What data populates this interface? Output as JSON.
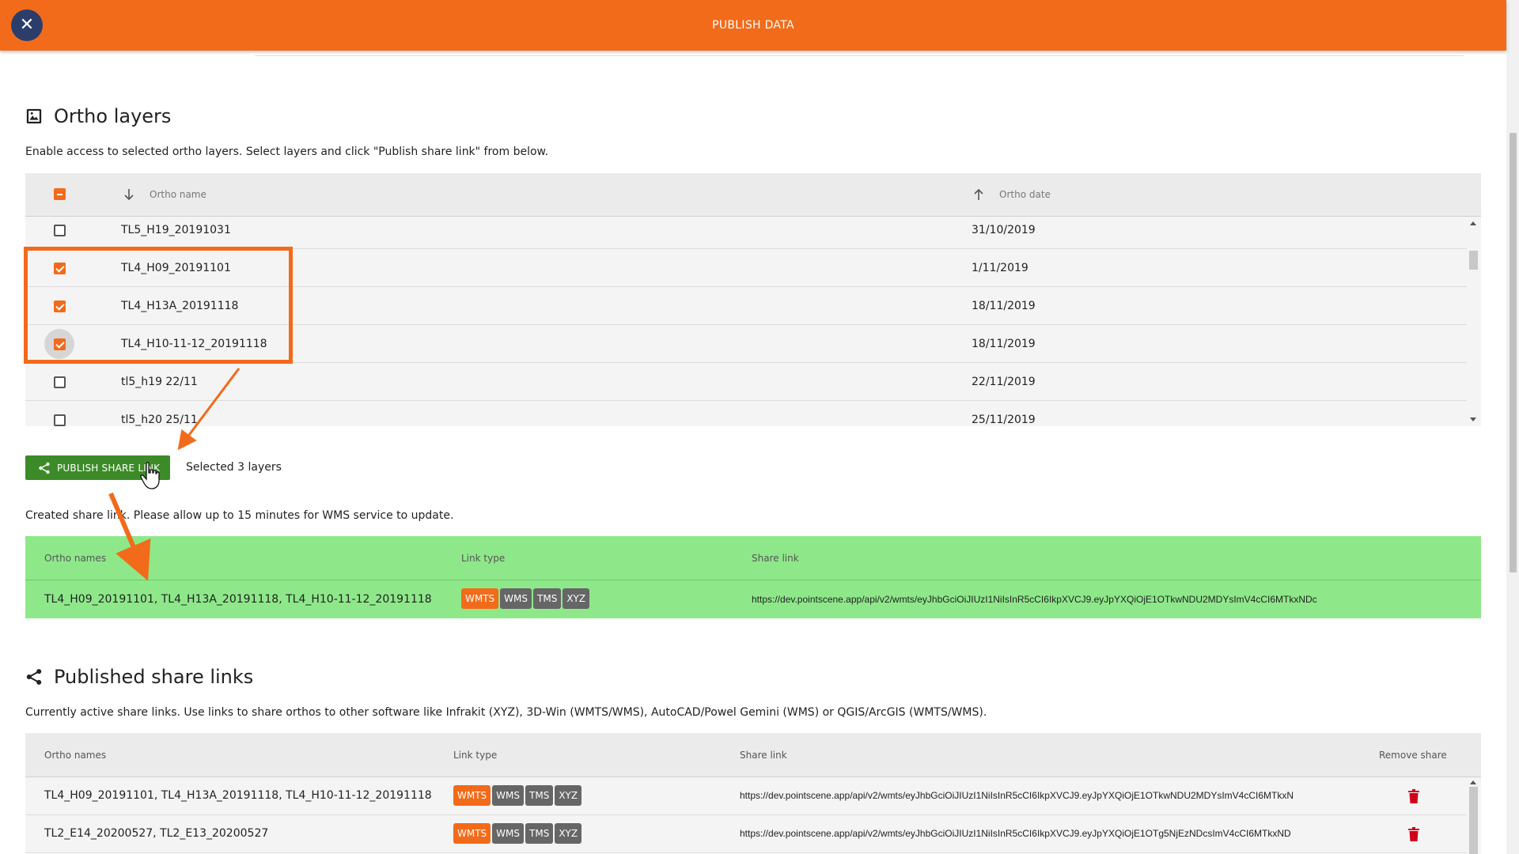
{
  "header": {
    "title": "PUBLISH DATA",
    "close_icon": "close-icon"
  },
  "ortho": {
    "title": "Ortho layers",
    "description": "Enable access to selected ortho layers. Select layers and click \"Publish share link\" from below.",
    "columns": {
      "name": "Ortho name",
      "date": "Ortho date"
    },
    "rows": [
      {
        "name": "TL5_H19_20191031",
        "date": "31/10/2019",
        "checked": false
      },
      {
        "name": "TL4_H09_20191101",
        "date": "1/11/2019",
        "checked": true
      },
      {
        "name": "TL4_H13A_20191118",
        "date": "18/11/2019",
        "checked": true
      },
      {
        "name": "TL4_H10-11-12_20191118",
        "date": "18/11/2019",
        "checked": true
      },
      {
        "name": "tl5_h19 22/11",
        "date": "22/11/2019",
        "checked": false
      },
      {
        "name": "tl5_h20 25/11",
        "date": "25/11/2019",
        "checked": false
      }
    ]
  },
  "publish": {
    "button_label": "PUBLISH SHARE LINK",
    "selected_text": "Selected 3 layers",
    "created_text": "Created share link. Please allow up to 15 minutes for WMS service to update."
  },
  "created_table": {
    "columns": {
      "names": "Ortho names",
      "type": "Link type",
      "link": "Share link"
    },
    "row": {
      "names": "TL4_H09_20191101, TL4_H13A_20191118, TL4_H10-11-12_20191118",
      "link": "https://dev.pointscene.app/api/v2/wmts/eyJhbGciOiJIUzI1NiIsInR5cCI6IkpXVCJ9.eyJpYXQiOjE1OTkwNDU2MDYsImV4cCI6MTkxNDc"
    }
  },
  "link_types": [
    "WMTS",
    "WMS",
    "TMS",
    "XYZ"
  ],
  "published": {
    "title": "Published share links",
    "description": "Currently active share links. Use links to share orthos to other software like Infrakit (XYZ), 3D-Win (WMTS/WMS), AutoCAD/Powel Gemini (WMS) or QGIS/ArcGIS (WMTS/WMS).",
    "columns": {
      "names": "Ortho names",
      "type": "Link type",
      "link": "Share link",
      "remove": "Remove share"
    },
    "rows": [
      {
        "names": "TL4_H09_20191101, TL4_H13A_20191118, TL4_H10-11-12_20191118",
        "link": "https://dev.pointscene.app/api/v2/wmts/eyJhbGciOiJIUzI1NiIsInR5cCI6IkpXVCJ9.eyJpYXQiOjE1OTkwNDU2MDYsImV4cCI6MTkxN"
      },
      {
        "names": "TL2_E14_20200527, TL2_E13_20200527",
        "link": "https://dev.pointscene.app/api/v2/wmts/eyJhbGciOiJIUzI1NiIsInR5cCI6IkpXVCJ9.eyJpYXQiOjE1OTg5NjEzNDcsImV4cCI6MTkxND"
      }
    ]
  },
  "colors": {
    "accent": "#f26b1a",
    "navy": "#2b3e6b",
    "publish_green": "#3d8b28",
    "created_bg": "#8ee88a",
    "remove_red": "#d0021b"
  }
}
